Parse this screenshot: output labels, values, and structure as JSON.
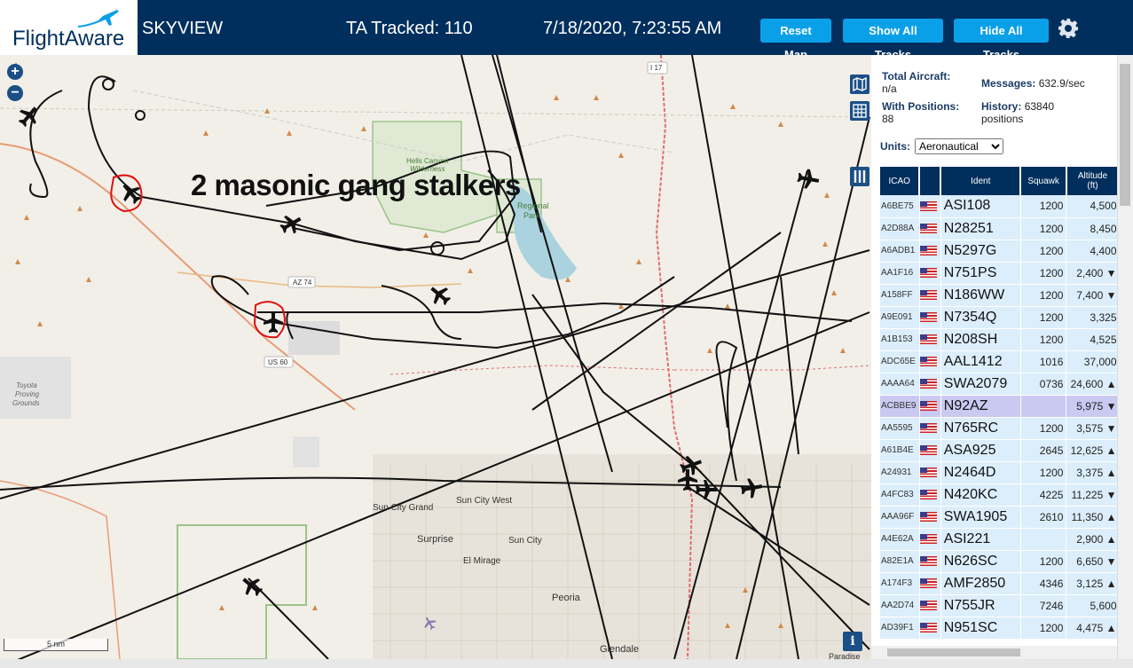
{
  "header": {
    "logo_text": "FlightAware",
    "app_title": "SKYVIEW",
    "tracked": "TA Tracked: 110",
    "datetime": "7/18/2020, 7:23:55 AM",
    "buttons": {
      "reset": "Reset Map",
      "show": "Show All Tracks",
      "hide": "Hide All Tracks"
    }
  },
  "map": {
    "annotation": "2 masonic gang stalkers",
    "scale": "5 nm",
    "labels": {
      "hells_canyon": "Hells Canyon",
      "wilderness": "Wilderness",
      "regional": "Regional",
      "park": "Park",
      "az74": "AZ 74",
      "us60": "US 60",
      "i17": "I 17",
      "toyota": "Toyota",
      "proving": "Proving",
      "grounds": "Grounds",
      "sun_city_grand": "Sun City Grand",
      "sun_city_west": "Sun City West",
      "surprise": "Surprise",
      "sun_city": "Sun City",
      "el_mirage": "El Mirage",
      "peoria": "Peoria",
      "glendale": "Glendale",
      "paradise": "Paradise Va"
    }
  },
  "stats": {
    "total_label": "Total Aircraft:",
    "total_value": "n/a",
    "positions_label": "With Positions:",
    "positions_value": "88",
    "messages_label": "Messages:",
    "messages_value": "632.9/sec",
    "history_label": "History:",
    "history_value": "63840",
    "history_unit": "positions",
    "units_label": "Units:",
    "units_value": "Aeronautical"
  },
  "table": {
    "headers": [
      "ICAO",
      "",
      "Ident",
      "Squawk",
      "Altitude (ft)"
    ],
    "rows": [
      {
        "icao": "A6BE75",
        "ident": "ASI108",
        "squawk": "1200",
        "alt": "4,500"
      },
      {
        "icao": "A2D88A",
        "ident": "N28251",
        "squawk": "1200",
        "alt": "8,450"
      },
      {
        "icao": "A6ADB1",
        "ident": "N5297G",
        "squawk": "1200",
        "alt": "4,400"
      },
      {
        "icao": "AA1F16",
        "ident": "N751PS",
        "squawk": "1200",
        "alt": "2,400 ▼"
      },
      {
        "icao": "A158FF",
        "ident": "N186WW",
        "squawk": "1200",
        "alt": "7,400 ▼"
      },
      {
        "icao": "A9E091",
        "ident": "N7354Q",
        "squawk": "1200",
        "alt": "3,325"
      },
      {
        "icao": "A1B153",
        "ident": "N208SH",
        "squawk": "1200",
        "alt": "4,525"
      },
      {
        "icao": "ADC65E",
        "ident": "AAL1412",
        "squawk": "1016",
        "alt": "37,000"
      },
      {
        "icao": "AAAA64",
        "ident": "SWA2079",
        "squawk": "0736",
        "alt": "24,600 ▲"
      },
      {
        "icao": "ACBBE9",
        "ident": "N92AZ",
        "squawk": "",
        "alt": "5,975 ▼"
      },
      {
        "icao": "AA5595",
        "ident": "N765RC",
        "squawk": "1200",
        "alt": "3,575 ▼"
      },
      {
        "icao": "A61B4E",
        "ident": "ASA925",
        "squawk": "2645",
        "alt": "12,625 ▲"
      },
      {
        "icao": "A24931",
        "ident": "N2464D",
        "squawk": "1200",
        "alt": "3,375 ▲"
      },
      {
        "icao": "A4FC83",
        "ident": "N420KC",
        "squawk": "4225",
        "alt": "11,225 ▼"
      },
      {
        "icao": "AAA96F",
        "ident": "SWA1905",
        "squawk": "2610",
        "alt": "11,350 ▲"
      },
      {
        "icao": "A4E62A",
        "ident": "ASI221",
        "squawk": "",
        "alt": "2,900 ▲"
      },
      {
        "icao": "A82E1A",
        "ident": "N626SC",
        "squawk": "1200",
        "alt": "6,650 ▼"
      },
      {
        "icao": "A174F3",
        "ident": "AMF2850",
        "squawk": "4346",
        "alt": "3,125 ▲"
      },
      {
        "icao": "AA2D74",
        "ident": "N755JR",
        "squawk": "7246",
        "alt": "5,600"
      },
      {
        "icao": "AD39F1",
        "ident": "N951SC",
        "squawk": "1200",
        "alt": "4,475 ▲"
      }
    ]
  },
  "colors": {
    "header_bg": "#002f5d",
    "button": "#0aa0e8",
    "map_bg": "#f2efe9",
    "row_bg": "#dceefb",
    "row_selected": "#c9c9f2"
  },
  "icons": [
    "zoom-in-icon",
    "zoom-out-icon",
    "map-layer-icon",
    "grid-icon",
    "columns-icon",
    "gear-icon",
    "info-icon",
    "plane-icon",
    "us-flag-icon"
  ]
}
